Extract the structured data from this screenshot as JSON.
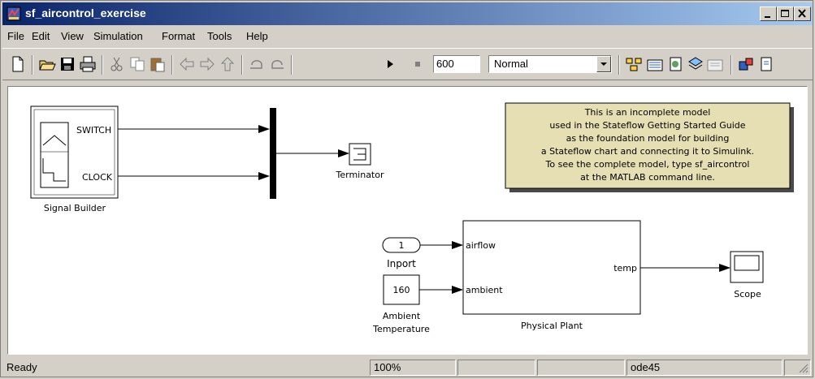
{
  "window": {
    "title": "sf_aircontrol_exercise"
  },
  "menu": [
    "File",
    "Edit",
    "View",
    "Simulation",
    "Format",
    "Tools",
    "Help"
  ],
  "toolbar": {
    "stop_time": "600",
    "sim_mode": "Normal"
  },
  "blocks": {
    "signal_builder": {
      "label": "Signal Builder",
      "out1": "SWITCH",
      "out2": "CLOCK"
    },
    "terminator": {
      "label": "Terminator"
    },
    "inport": {
      "value": "1",
      "label": "Inport"
    },
    "ambient": {
      "value": "160",
      "label1": "Ambient",
      "label2": "Temperature"
    },
    "plant": {
      "label": "Physical Plant",
      "in1": "airflow",
      "in2": "ambient",
      "out": "temp"
    },
    "scope": {
      "label": "Scope"
    }
  },
  "annotation": {
    "lines": [
      "This is an incomplete model",
      "used in the Stateflow Getting Started Guide",
      "as the foundation model for building",
      "a Stateflow chart and connecting it to Simulink.",
      "To see the complete model, type sf_aircontrol",
      "at the MATLAB command line."
    ]
  },
  "status": {
    "state": "Ready",
    "zoom": "100%",
    "solver": "ode45"
  },
  "colors": {
    "titlebar_start": "#0a246a",
    "titlebar_end": "#a6caf0",
    "annotation_bg": "#e6dfb4"
  }
}
